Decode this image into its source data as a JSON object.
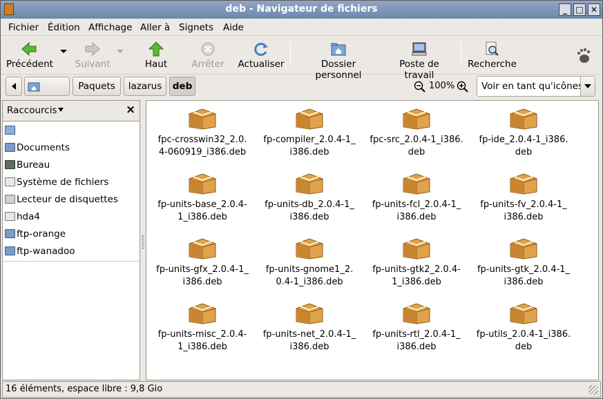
{
  "window": {
    "title": "deb - Navigateur de fichiers"
  },
  "menu": [
    {
      "label": "Fichier"
    },
    {
      "label": "Édition"
    },
    {
      "label": "Affichage"
    },
    {
      "label": "Aller à"
    },
    {
      "label": "Signets"
    },
    {
      "label": "Aide"
    }
  ],
  "toolbar": {
    "back": "Précédent",
    "forward": "Suivant",
    "up": "Haut",
    "stop": "Arrêter",
    "reload": "Actualiser",
    "home": "Dossier personnel",
    "computer": "Poste de travail",
    "search": "Recherche"
  },
  "pathbar": {
    "segments": [
      "Paquets",
      "lazarus",
      "deb"
    ],
    "zoom": "100%",
    "view_mode": "Voir en tant qu'icônes"
  },
  "sidebar": {
    "title": "Raccourcis",
    "close": "×",
    "items": [
      {
        "label": "",
        "icon": "home-folder-icon"
      },
      {
        "label": "Documents",
        "icon": "folder-icon"
      },
      {
        "label": "Bureau",
        "icon": "desktop-icon"
      },
      {
        "label": "Système de fichiers",
        "icon": "drive-icon"
      },
      {
        "label": "Lecteur de disquettes",
        "icon": "floppy-icon"
      },
      {
        "label": "hda4",
        "icon": "drive-icon"
      },
      {
        "label": "ftp-orange",
        "icon": "network-folder-icon"
      },
      {
        "label": "ftp-wanadoo",
        "icon": "network-folder-icon"
      }
    ]
  },
  "files": [
    {
      "line1": "fpc-crosswin32_2.0.",
      "line2": "4-060919_i386.deb"
    },
    {
      "line1": "fp-compiler_2.0.4-1_",
      "line2": "i386.deb"
    },
    {
      "line1": "fpc-src_2.0.4-1_i386.",
      "line2": "deb"
    },
    {
      "line1": "fp-ide_2.0.4-1_i386.",
      "line2": "deb"
    },
    {
      "line1": "fp-units-base_2.0.4-",
      "line2": "1_i386.deb"
    },
    {
      "line1": "fp-units-db_2.0.4-1_",
      "line2": "i386.deb"
    },
    {
      "line1": "fp-units-fcl_2.0.4-1_",
      "line2": "i386.deb"
    },
    {
      "line1": "fp-units-fv_2.0.4-1_",
      "line2": "i386.deb"
    },
    {
      "line1": "fp-units-gfx_2.0.4-1_",
      "line2": "i386.deb"
    },
    {
      "line1": "fp-units-gnome1_2.",
      "line2": "0.4-1_i386.deb"
    },
    {
      "line1": "fp-units-gtk2_2.0.4-",
      "line2": "1_i386.deb"
    },
    {
      "line1": "fp-units-gtk_2.0.4-1_",
      "line2": "i386.deb"
    },
    {
      "line1": "fp-units-misc_2.0.4-",
      "line2": "1_i386.deb"
    },
    {
      "line1": "fp-units-net_2.0.4-1_",
      "line2": "i386.deb"
    },
    {
      "line1": "fp-units-rtl_2.0.4-1_",
      "line2": "i386.deb"
    },
    {
      "line1": "fp-utils_2.0.4-1_i386.",
      "line2": "deb"
    }
  ],
  "status": "16 éléments, espace libre : 9,8 Gio"
}
